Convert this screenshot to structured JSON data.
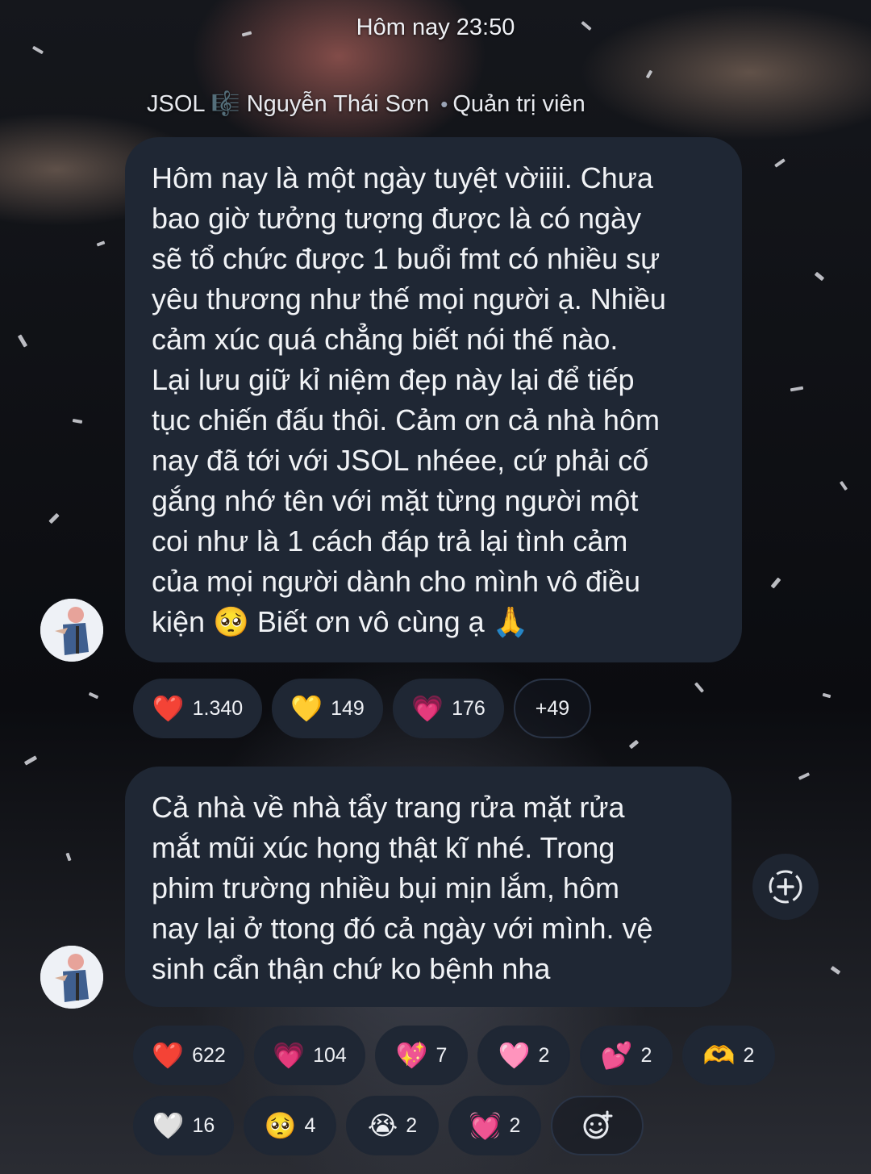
{
  "timestamp": "Hôm nay 23:50",
  "sender": {
    "channel": "JSOL",
    "channel_icon": "🎼",
    "name": "Nguyễn Thái Sơn",
    "separator": "•",
    "role": "Quản trị viên"
  },
  "messages": [
    {
      "text": "Hôm nay là một ngày tuyệt vờiiii. Chưa\nbao giờ tưởng tượng được là có ngày\nsẽ tổ chức được 1 buổi fmt có nhiều sự\nyêu thương như thế mọi người ạ. Nhiều\ncảm xúc quá chẳng biết nói thế nào.\nLại lưu giữ kỉ niệm đẹp này lại để tiếp\ntục chiến đấu thôi. Cảm ơn cả nhà hôm\nnay đã tới với JSOL nhéee, cứ phải cố\ngắng nhớ tên với mặt từng người một\ncoi như là 1 cách đáp trả lại tình cảm\ncủa mọi người dành cho mình vô điều\nkiện 🥺 Biết ơn vô cùng ạ 🙏",
      "reactions": [
        {
          "emoji": "❤️",
          "count": "1.340"
        },
        {
          "emoji": "💛",
          "count": "149"
        },
        {
          "emoji": "💗",
          "count": "176"
        }
      ],
      "more": "+49"
    },
    {
      "text": "Cả nhà về nhà tẩy trang rửa mặt rửa\nmắt mũi xúc họng thật kĩ nhé. Trong\nphim trường nhiều bụi mịn lắm, hôm\nnay lại ở ttong đó cả ngày với mình. vệ\nsinh cẩn thận chứ ko bệnh nha",
      "reactions_row1": [
        {
          "emoji": "❤️",
          "count": "622"
        },
        {
          "emoji": "💗",
          "count": "104"
        },
        {
          "emoji": "💖",
          "count": "7"
        },
        {
          "emoji": "🩷",
          "count": "2"
        },
        {
          "emoji": "💕",
          "count": "2"
        },
        {
          "emoji": "🫶",
          "count": "2"
        }
      ],
      "reactions_row2": [
        {
          "emoji": "🤍",
          "count": "16"
        },
        {
          "emoji": "🥺",
          "count": "4"
        },
        {
          "emoji": "😭",
          "count": "2"
        },
        {
          "emoji": "💓",
          "count": "2"
        }
      ]
    }
  ],
  "icons": {
    "add_reaction": "add-emoji-icon",
    "add_button": "add-circle-icon"
  }
}
